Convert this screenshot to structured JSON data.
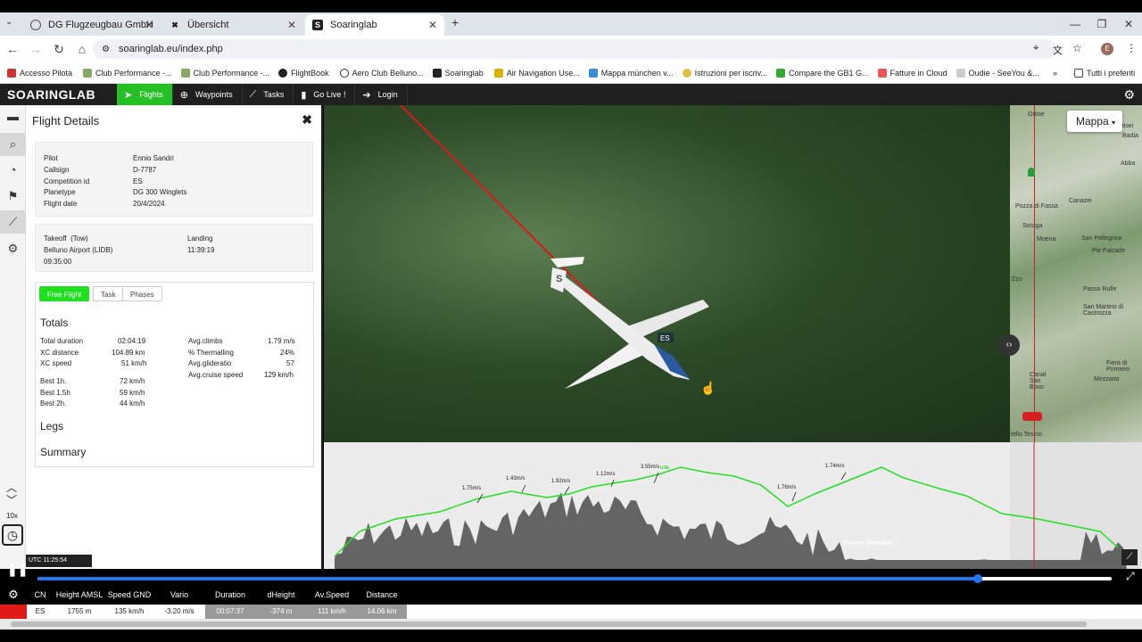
{
  "browser": {
    "tabs": [
      {
        "title": "DG Flugzeugbau GmbH"
      },
      {
        "title": "Übersicht"
      },
      {
        "title": "Soaringlab"
      }
    ],
    "url": "soaringlab.eu/index.php",
    "bookmarks": [
      "Accesso Pilota",
      "Club Performance -...",
      "Club Performance -...",
      "FlightBook",
      "Aero Club Belluno...",
      "Soaringlab",
      "Air Navigation Use...",
      "Mappa münchen v...",
      "Istruzioni per iscriv...",
      "Compare the GB1 G...",
      "Fatture in Cloud",
      "Oudie - SeeYou &..."
    ],
    "all_bookmarks": "Tutti i preferiti",
    "profile_initial": "E"
  },
  "app": {
    "logo": "SOARINGLAB",
    "menu": [
      "Flights",
      "Waypoints",
      "Tasks",
      "Go Live !",
      "Login"
    ]
  },
  "panel": {
    "title": "Flight Details",
    "info": [
      {
        "label": "Pilot",
        "value": "Ennio Sandri"
      },
      {
        "label": "Callsign",
        "value": "D-7787"
      },
      {
        "label": "Competition id",
        "value": "ES"
      },
      {
        "label": "Planetype",
        "value": "DG 300 Winglets"
      },
      {
        "label": "Flight date",
        "value": "20/4/2024"
      }
    ],
    "takeoff_label": "Takeoff",
    "takeoff_tow": "(Tow)",
    "takeoff_airport": "Belluno Airport (LIDB)",
    "takeoff_time": "09:35:00",
    "landing_label": "Landing",
    "landing_time": "11:39:19",
    "subtabs": [
      "Free Flight",
      "Task",
      "Phases"
    ],
    "totals_title": "Totals",
    "totals_left": [
      {
        "label": "Total duration",
        "value": "02:04:19"
      },
      {
        "label": "XC distance",
        "value": "104.89 km"
      },
      {
        "label": "XC speed",
        "value": "51 km/h"
      },
      {
        "label": "Best 1h.",
        "value": "72 km/h"
      },
      {
        "label": "Best 1.5h",
        "value": "59 km/h"
      },
      {
        "label": "Best 2h.",
        "value": "44 km/h"
      }
    ],
    "totals_right": [
      {
        "label": "Avg.climbs",
        "value": "1.79 m/s"
      },
      {
        "label": "% Thermalling",
        "value": "24%"
      },
      {
        "label": "Avg.glideratio",
        "value": "57"
      },
      {
        "label": "Avg.cruise speed",
        "value": "129 km/h"
      }
    ],
    "legs_title": "Legs",
    "summary_title": "Summary"
  },
  "view3d": {
    "glider_label": "ES",
    "tail_letter": "S"
  },
  "map": {
    "button": "Mappa",
    "labels": [
      "Ortise",
      "Canazei",
      "Pozza di Fassa",
      "Soraga",
      "Moena",
      "San Pellegrino",
      "Pie Falcade",
      "Passo Rolle",
      "San Martino di Castrozza",
      "Fiera di Primiero",
      "Mezzano",
      "Canal San Bovo",
      "Abba",
      "Ortisei",
      "Badia",
      "Zzo",
      "tello Tesino"
    ]
  },
  "chart": {
    "terrain_label": "Terrain Elevation",
    "climbs": [
      "1.75m/s",
      "1.43m/s",
      "1.92m/s",
      "1.12m/s",
      "3.55m/s",
      "1.76m/s",
      "1.74m/s"
    ],
    "altitude_label": "ude",
    "colors": {
      "flight": "#22e022",
      "terrain": "#555555"
    }
  },
  "controls": {
    "speed": "10x",
    "utc": "UTC 11:25:54",
    "progress": 0.875
  },
  "stats": {
    "headers": [
      "CN",
      "Height AMSL",
      "Speed GND",
      "Vario",
      "Duration",
      "dHeight",
      "Av.Speed",
      "Distance"
    ],
    "values": [
      "ES",
      "1755 m",
      "135 km/h",
      "-3.20 m/s",
      "00:07:37",
      "-374 m",
      "111 km/h",
      "14.06 km"
    ]
  }
}
